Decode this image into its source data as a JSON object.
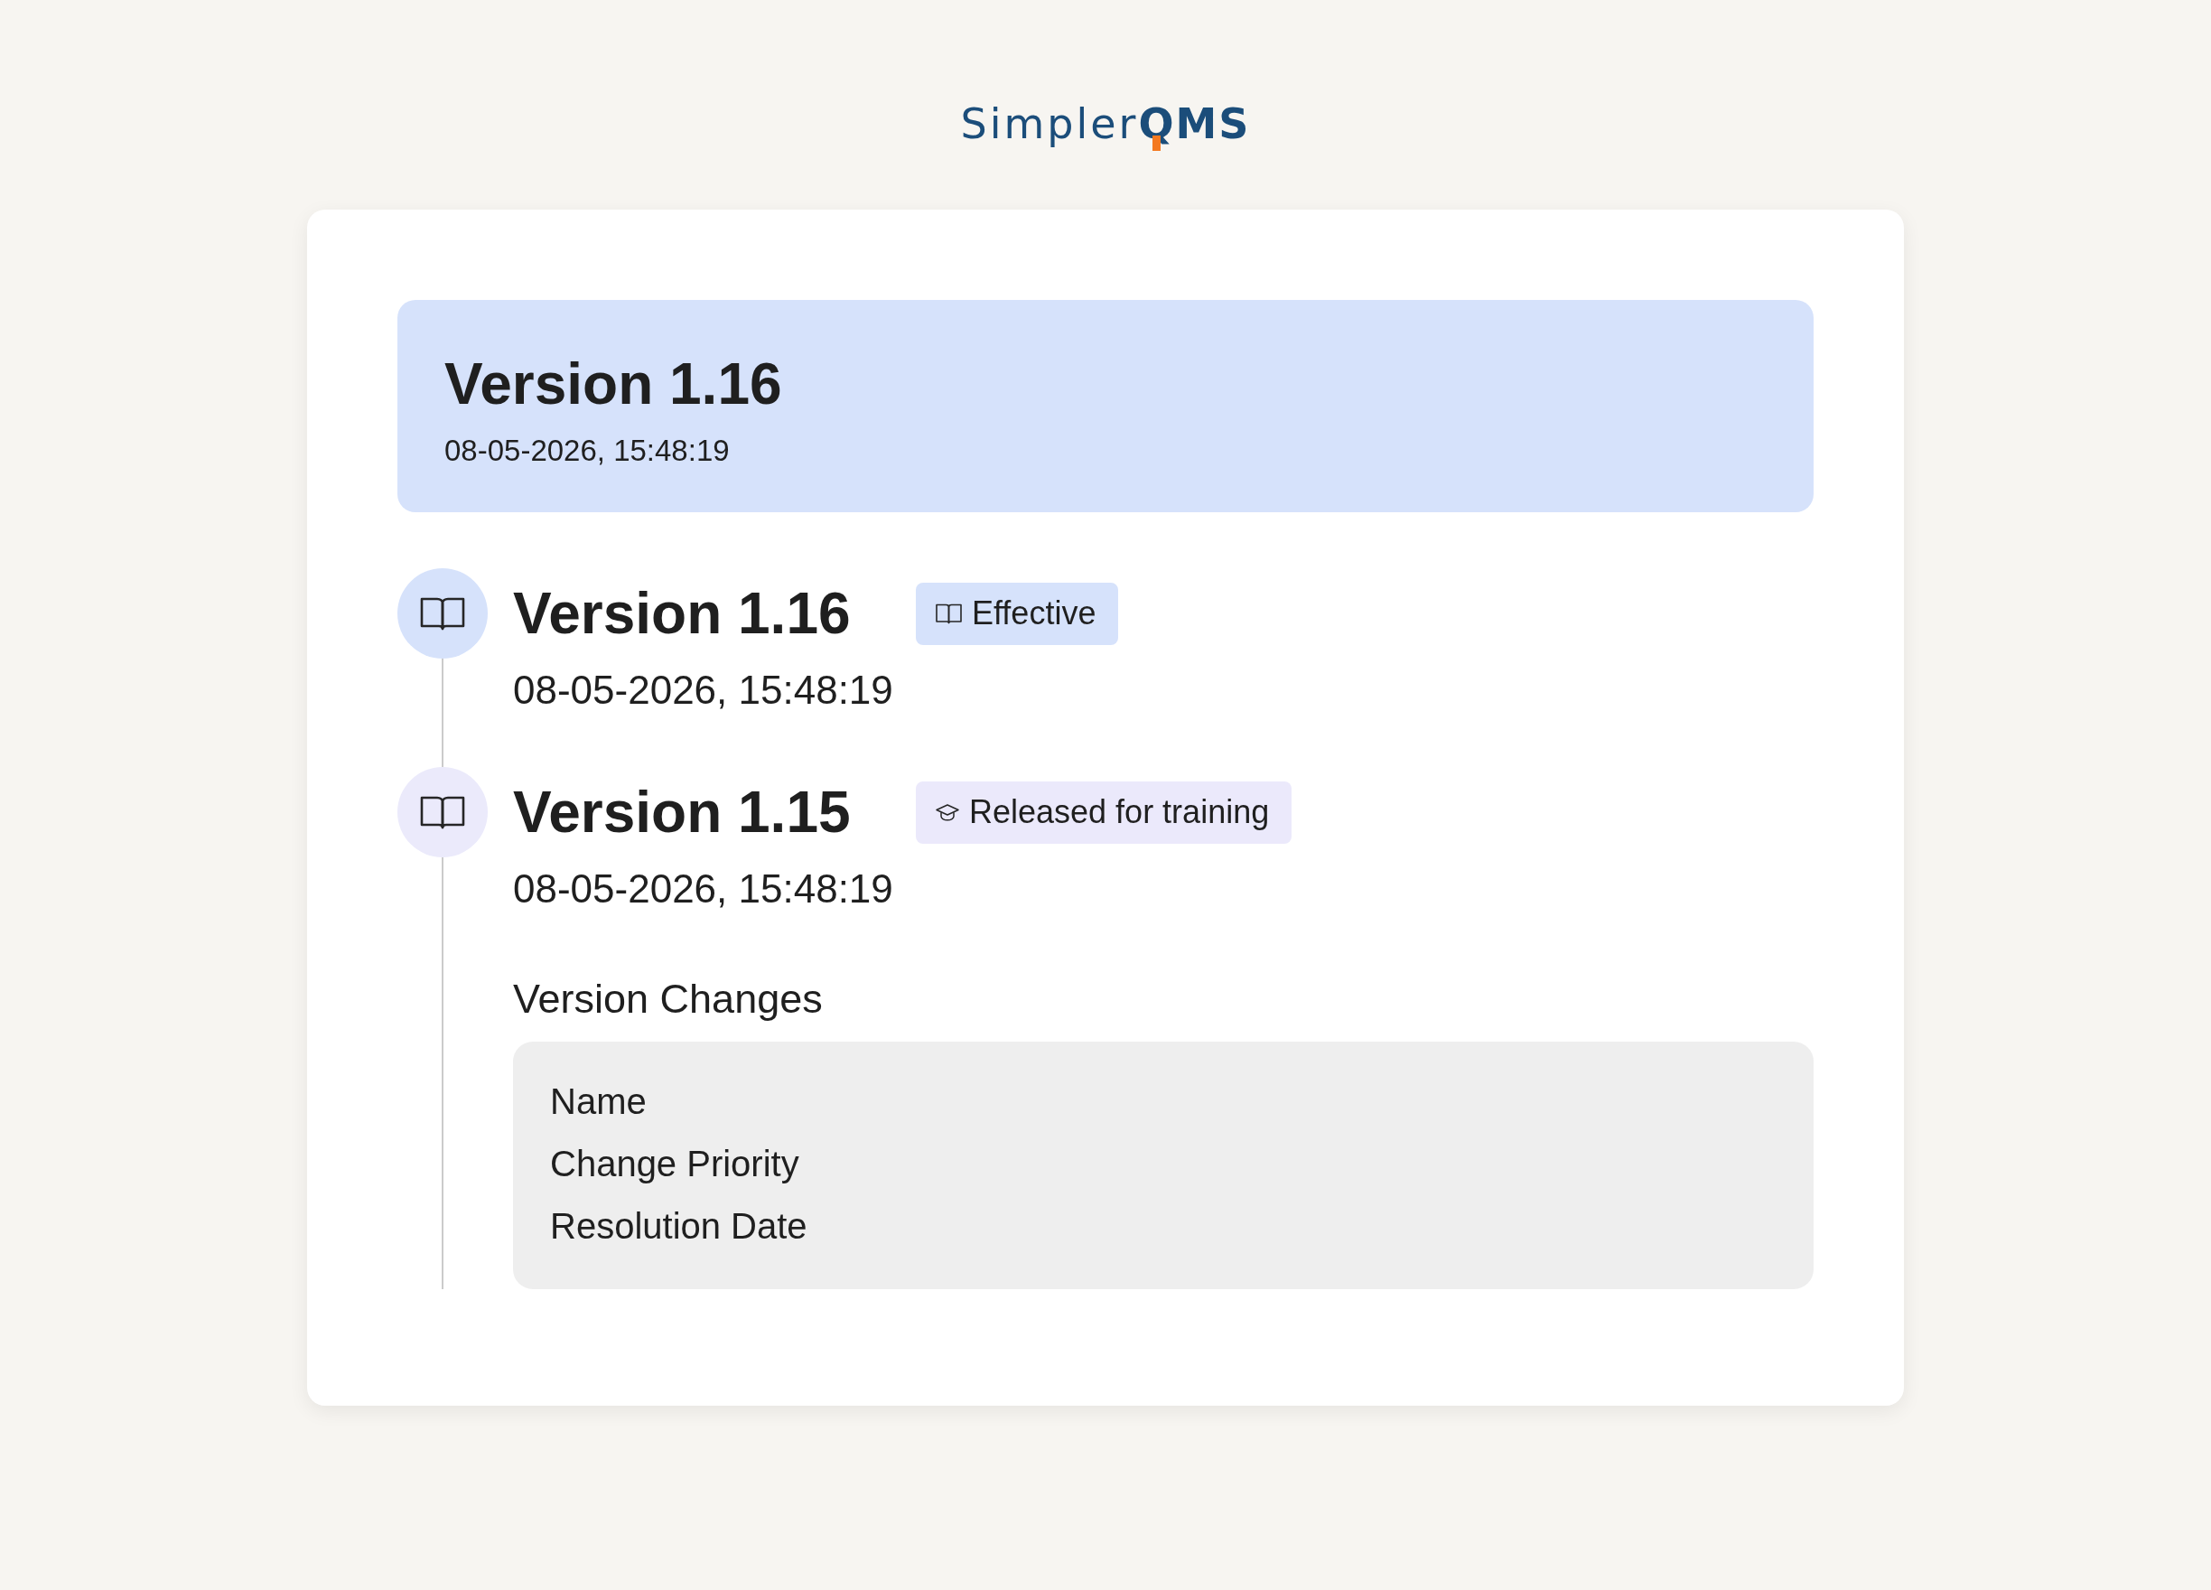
{
  "logo": {
    "regular": "Simpler",
    "bold": "QMS"
  },
  "current_version": {
    "title": "Version 1.16",
    "date": "08-05-2026, 15:48:19"
  },
  "timeline": [
    {
      "title": "Version 1.16",
      "date": "08-05-2026, 15:48:19",
      "status": {
        "kind": "effective",
        "label": "Effective"
      }
    },
    {
      "title": "Version 1.15",
      "date": "08-05-2026, 15:48:19",
      "status": {
        "kind": "training",
        "label": "Released for training"
      },
      "changes": {
        "heading": "Version Changes",
        "items": [
          "Name",
          "Change Priority",
          "Resolution Date"
        ]
      }
    }
  ]
}
